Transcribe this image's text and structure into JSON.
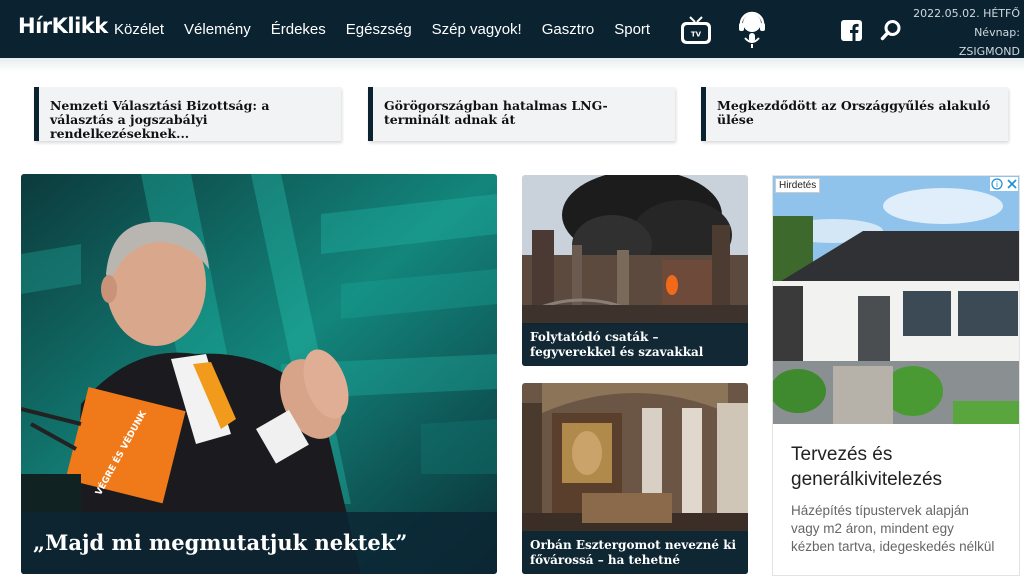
{
  "header": {
    "logo": "HírKlikk",
    "nav": [
      "Közélet",
      "Vélemény",
      "Érdekes",
      "Egészség",
      "Szép vagyok!",
      "Gasztro",
      "Sport"
    ],
    "date": "2022.05.02. HÉTFŐ",
    "nameday_label": "Névnap:",
    "nameday": "ZSIGMOND",
    "tv_badge": "KlikkTV",
    "icons": [
      "klikk-tv-icon",
      "podcast-icon",
      "facebook-icon",
      "search-icon"
    ]
  },
  "headlines": [
    "Nemzeti Választási Bizottság: a választás a jogszabályi rendelkezéseknek...",
    "Görögországban hatalmas LNG-terminált adnak át",
    "Megkezdődött az Országgyűlés alakuló ülése"
  ],
  "hero": {
    "caption": "„Majd mi megmutatjuk nektek”",
    "podium_text": "VÉGRE ÉS VÉDUNK"
  },
  "cards": [
    {
      "caption": "Folytatódó csaták – fegyverekkel és szavakkal"
    },
    {
      "caption": "Orbán Esztergomot nevezné ki fővárossá – ha tehetné"
    }
  ],
  "ad": {
    "label": "Hirdetés",
    "title": "Tervezés és generálkivitelezés",
    "body": "Házépítés típustervek alapján vagy m2 áron, mindent egy kézben tartva, idegeskedés nélkül"
  },
  "colors": {
    "header_bg": "#0b2230",
    "accent_orange": "#f07a1a",
    "hero_teal": "#17a89a"
  }
}
